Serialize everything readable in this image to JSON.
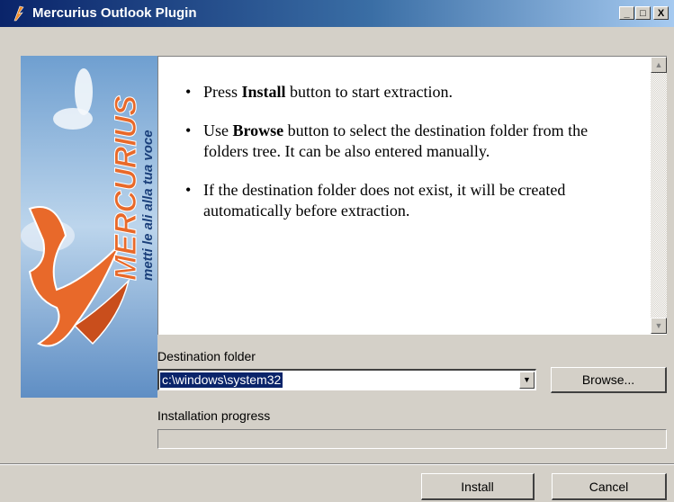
{
  "window": {
    "title": "Mercurius Outlook Plugin",
    "controls": {
      "minimize": "_",
      "maximize": "□",
      "close": "X"
    }
  },
  "banner": {
    "brand": "MERCURIUS",
    "tagline": "metti le ali alla tua voce"
  },
  "instructions": {
    "items": [
      {
        "pre": "Press ",
        "bold": "Install",
        "post": " button to start extraction."
      },
      {
        "pre": "Use ",
        "bold": "Browse",
        "post": " button to select the destination folder from the folders tree. It can be also entered manually."
      },
      {
        "pre": "If the destination folder does not exist, it will be created automatically before extraction.",
        "bold": "",
        "post": ""
      }
    ]
  },
  "destination": {
    "label": "Destination folder",
    "value": "c:\\windows\\system32",
    "browse_label": "Browse..."
  },
  "progress": {
    "label": "Installation progress",
    "percent": 0
  },
  "footer": {
    "install_label": "Install",
    "cancel_label": "Cancel"
  }
}
